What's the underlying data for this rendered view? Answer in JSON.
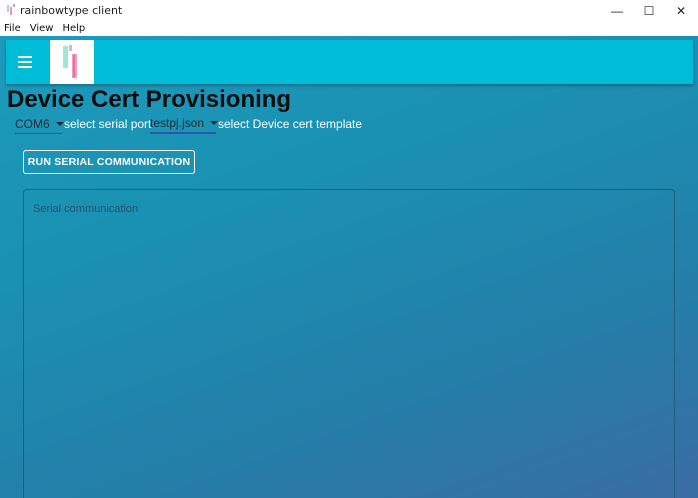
{
  "window": {
    "title": "rainbowtype client",
    "minimize_glyph": "—",
    "maximize_glyph": "☐",
    "close_glyph": "✕"
  },
  "menubar": {
    "items": [
      "File",
      "View",
      "Help"
    ]
  },
  "appbar": {
    "menu_icon": "hamburger-menu-icon",
    "logo": "rainbowtype-logo"
  },
  "page": {
    "title": "Device Cert Provisioning"
  },
  "serial_port": {
    "selected": "COM6",
    "helper": "select serial port"
  },
  "cert_template": {
    "selected": "testpj.json",
    "helper": "select Device cert template"
  },
  "run_button": {
    "label": "RUN SERIAL COMMUNICATION"
  },
  "serial_output": {
    "placeholder": "Serial communication"
  },
  "colors": {
    "appbar": "#00bcd6",
    "background_top": "#1c9bbd",
    "background_bottom": "#3a6ca3",
    "template_underline": "#3153a8"
  }
}
